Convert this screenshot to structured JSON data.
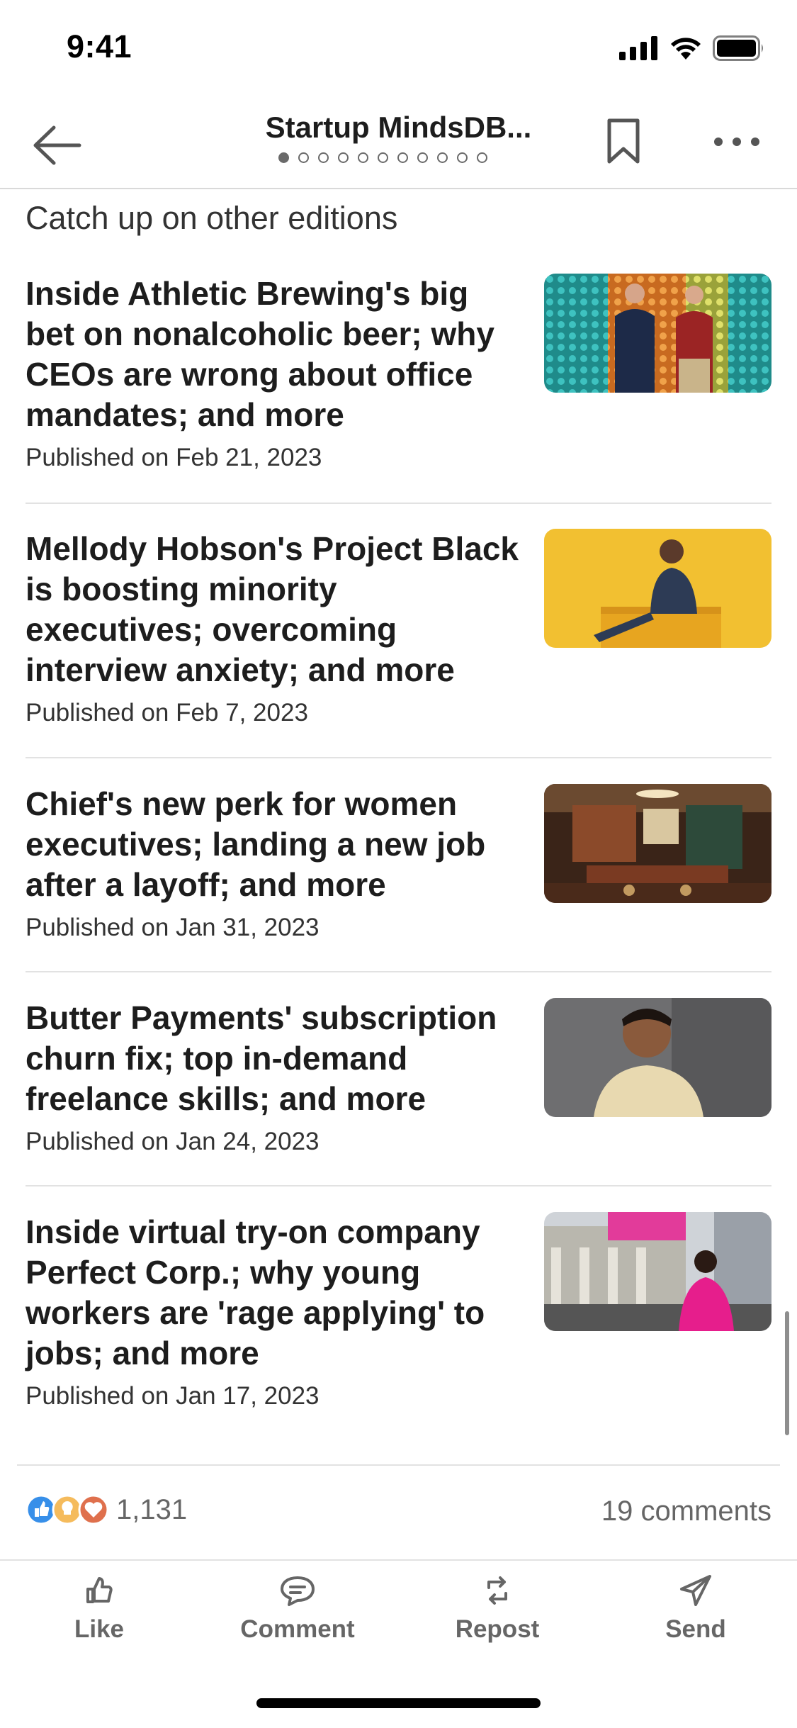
{
  "status": {
    "time": "9:41"
  },
  "header": {
    "title": "Startup MindsDB...",
    "page_count": 11,
    "active_page": 1
  },
  "section_title": "Catch up on other editions",
  "items": [
    {
      "title": "Inside Athletic Brewing's big bet on nonalcoholic beer; why CEOs are wrong about office mandates; and more",
      "date": "Published on Feb 21, 2023",
      "thumb": "two-men-in-front-of-can-wall"
    },
    {
      "title": "Mellody Hobson's Project Black is boosting minority executives; overcoming interview anxiety; and more",
      "date": "Published on Feb 7, 2023",
      "thumb": "woman-on-yellow-background"
    },
    {
      "title": "Chief's new perk for women executives; landing a new job after a layoff; and more",
      "date": "Published on Jan 31, 2023",
      "thumb": "lounge-interior"
    },
    {
      "title": "Butter Payments' subscription churn fix; top in-demand freelance skills; and more",
      "date": "Published on Jan 24, 2023",
      "thumb": "man-portrait-gray-background"
    },
    {
      "title": "Inside virtual try-on company Perfect Corp.; why young workers are 'rage applying' to jobs; and more",
      "date": "Published on Jan 17, 2023",
      "thumb": "woman-at-stock-exchange"
    }
  ],
  "social": {
    "reaction_count": "1,131",
    "comments": "19 comments"
  },
  "actions": {
    "like": "Like",
    "comment": "Comment",
    "repost": "Repost",
    "send": "Send"
  },
  "colors": {
    "text": "#1d1d1d",
    "muted": "#666666",
    "divider": "#e2e2e2",
    "like_blue": "#378fe9",
    "insight_yellow": "#f5bb5c",
    "love_red": "#df704d"
  }
}
